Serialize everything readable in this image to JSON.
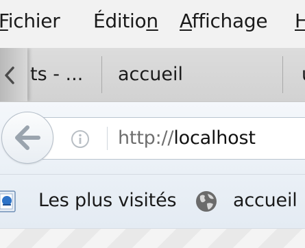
{
  "menubar": {
    "items": [
      {
        "before": "",
        "accel": "F",
        "after": "ichier"
      },
      {
        "before": "Éditio",
        "accel": "n",
        "after": ""
      },
      {
        "before": "",
        "accel": "A",
        "after": "ffichage"
      },
      {
        "before": "",
        "accel": "H",
        "after": ""
      }
    ]
  },
  "tabs": [
    {
      "label": "ts - ..."
    },
    {
      "label": "accueil"
    },
    {
      "label": "u"
    }
  ],
  "navbar": {
    "url_scheme": "http://",
    "url_host": "localhost"
  },
  "bookmarks": [
    {
      "label": "Les plus visités",
      "icon": "bookmark-star-icon"
    },
    {
      "label": "accueil",
      "icon": "globe-icon"
    }
  ],
  "colors": {
    "menubar_bg": "#f2f2f2",
    "tabstrip_bg": "#d8d8d8",
    "navbar_bg": "#eef3f8",
    "url_scheme": "#6e6e6e",
    "text": "#1a1a1a"
  }
}
